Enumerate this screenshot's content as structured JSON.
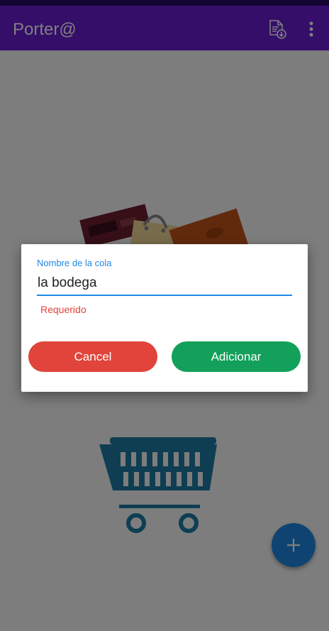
{
  "app": {
    "title": "Porter@"
  },
  "toolbar": {
    "icons": [
      "file-download-icon",
      "more-vert-icon"
    ]
  },
  "fab": {
    "icon": "plus-icon"
  },
  "dialog": {
    "field_label": "Nombre de la cola",
    "field_value": "la bodega",
    "error_text": "Requerido",
    "cancel_label": "Cancel",
    "confirm_label": "Adicionar"
  },
  "colors": {
    "app_bar": "#6a1cd4",
    "status_bar": "#2a0a66",
    "accent": "#1e88e5",
    "error": "#e0443a",
    "confirm": "#12a05a"
  }
}
